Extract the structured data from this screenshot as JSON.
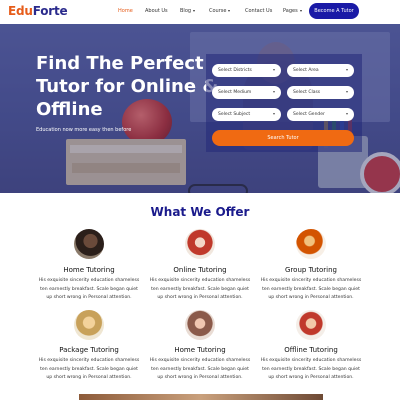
{
  "brand": {
    "part1": "Edu",
    "part2": "Forte"
  },
  "nav": {
    "home": "Home",
    "about": "About Us",
    "blog": "Blog",
    "course": "Course",
    "contact": "Contact Us",
    "pages": "Pages",
    "cta": "Become A Tutor"
  },
  "hero": {
    "title_lines": [
      "Find The Perfect",
      "Tutor for Online &",
      "Offline"
    ],
    "subtitle": "Education now more easy then before"
  },
  "search": {
    "district": "Select Districts",
    "area": "Select Area",
    "medium": "Select Medium",
    "class": "Select Class",
    "subject": "Select Subject",
    "gender": "Select Gender",
    "button": "Search Tutor"
  },
  "offer": {
    "title": "What We Offer",
    "desc_lines": [
      "His exquisite sincerity education shameless",
      "ten earnestly breakfast. Scale began quiet",
      "up short wrong in Personal attention."
    ],
    "items": [
      {
        "title": "Home Tutoring"
      },
      {
        "title": "Online Tutoring"
      },
      {
        "title": "Group Tutoring"
      },
      {
        "title": "Package Tutoring"
      },
      {
        "title": "Home Tutoring"
      },
      {
        "title": "Offline Tutoring"
      }
    ]
  },
  "colors": {
    "brand_orange": "#e65c1a",
    "brand_navy": "#1a1aa6",
    "heading_navy": "#1a1a8c",
    "search_orange": "#f06a12"
  }
}
